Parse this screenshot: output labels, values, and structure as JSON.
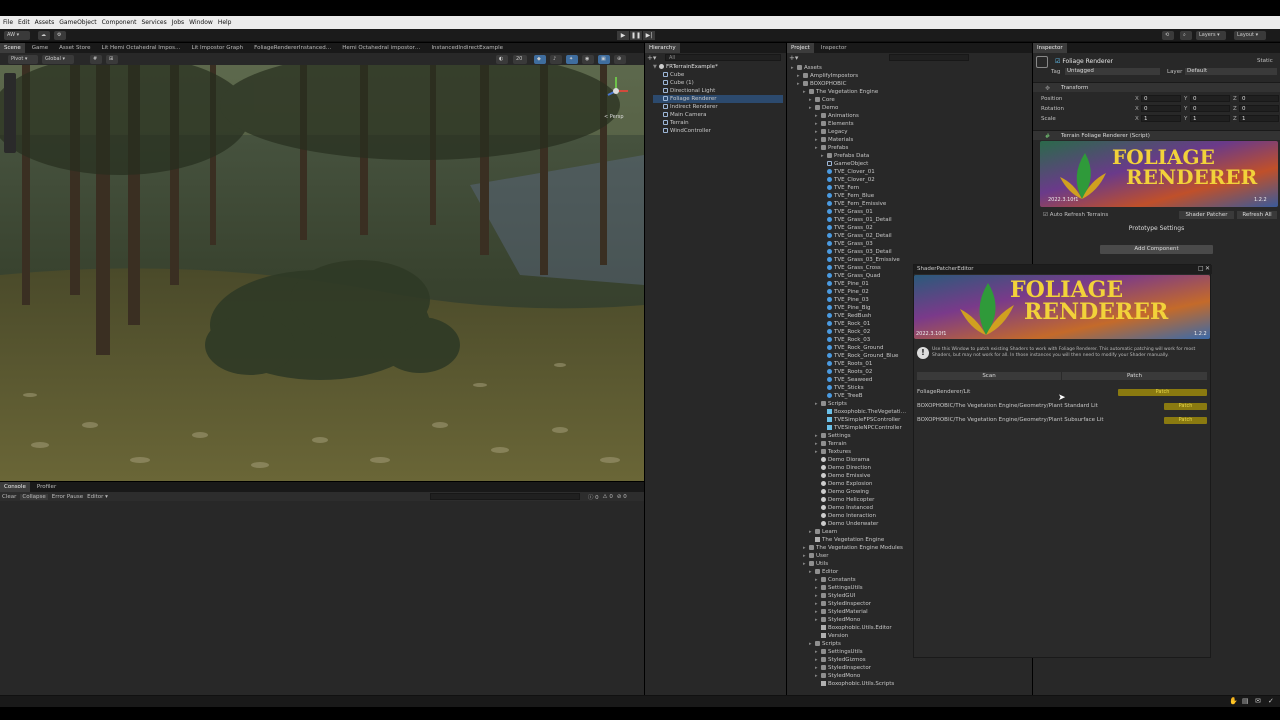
{
  "menu": [
    "File",
    "Edit",
    "Assets",
    "GameObject",
    "Component",
    "Services",
    "Jobs",
    "Window",
    "Help"
  ],
  "toolbar": {
    "account": "AW",
    "layers": "Layers",
    "layout": "Layout"
  },
  "scene_tabs": [
    "Scene",
    "Game",
    "Asset Store",
    "Lit Hemi Octahedral Impos…",
    "Lit Impostor Graph",
    "FoliageRendererInstanced…",
    "Hemi Octahedral impostor…",
    "InstancedIndirectExample"
  ],
  "scene_tools": {
    "pivot": "Pivot",
    "global": "Global",
    "persp": "< Persp",
    "grid_num": "20"
  },
  "console": {
    "tabs": [
      "Console",
      "Profiler"
    ],
    "clear": "Clear",
    "collapse": "Collapse",
    "error_pause": "Error Pause",
    "editor": "Editor",
    "count1": "0",
    "count2": "0",
    "count3": "0"
  },
  "hierarchy": {
    "title": "Hierarchy",
    "search_placeholder": "All",
    "scene": "FRTerrainExample*",
    "items": [
      "Cube",
      "Cube (1)",
      "Directional Light",
      "Foliage Renderer",
      "Indirect Renderer",
      "Main Camera",
      "Terrain",
      "WindController"
    ]
  },
  "project": {
    "tabs": [
      "Project",
      "Inspector"
    ],
    "items": [
      {
        "d": 0,
        "t": "Assets",
        "i": "folder"
      },
      {
        "d": 1,
        "t": "AmplifyImpostors",
        "i": "folder"
      },
      {
        "d": 1,
        "t": "BOXOPHOBIC",
        "i": "folder"
      },
      {
        "d": 2,
        "t": "The Vegetation Engine",
        "i": "folder"
      },
      {
        "d": 3,
        "t": "Core",
        "i": "folder"
      },
      {
        "d": 3,
        "t": "Demo",
        "i": "folder"
      },
      {
        "d": 4,
        "t": "Animations",
        "i": "folder"
      },
      {
        "d": 4,
        "t": "Elements",
        "i": "folder"
      },
      {
        "d": 4,
        "t": "Legacy",
        "i": "folder"
      },
      {
        "d": 4,
        "t": "Materials",
        "i": "folder"
      },
      {
        "d": 4,
        "t": "Prefabs",
        "i": "folder"
      },
      {
        "d": 5,
        "t": "Prefabs Data",
        "i": "folder"
      },
      {
        "d": 5,
        "t": "GameObject",
        "i": "cube"
      },
      {
        "d": 5,
        "t": "TVE_Clover_01",
        "i": "tve"
      },
      {
        "d": 5,
        "t": "TVE_Clover_02",
        "i": "tve"
      },
      {
        "d": 5,
        "t": "TVE_Fern",
        "i": "tve"
      },
      {
        "d": 5,
        "t": "TVE_Fern_Blue",
        "i": "tve"
      },
      {
        "d": 5,
        "t": "TVE_Fern_Emissive",
        "i": "tve"
      },
      {
        "d": 5,
        "t": "TVE_Grass_01",
        "i": "tve"
      },
      {
        "d": 5,
        "t": "TVE_Grass_01_Detail",
        "i": "tve"
      },
      {
        "d": 5,
        "t": "TVE_Grass_02",
        "i": "tve"
      },
      {
        "d": 5,
        "t": "TVE_Grass_02_Detail",
        "i": "tve"
      },
      {
        "d": 5,
        "t": "TVE_Grass_03",
        "i": "tve"
      },
      {
        "d": 5,
        "t": "TVE_Grass_03_Detail",
        "i": "tve"
      },
      {
        "d": 5,
        "t": "TVE_Grass_03_Emissive",
        "i": "tve"
      },
      {
        "d": 5,
        "t": "TVE_Grass_Cross",
        "i": "tve"
      },
      {
        "d": 5,
        "t": "TVE_Grass_Quad",
        "i": "tve"
      },
      {
        "d": 5,
        "t": "TVE_Pine_01",
        "i": "tve"
      },
      {
        "d": 5,
        "t": "TVE_Pine_02",
        "i": "tve"
      },
      {
        "d": 5,
        "t": "TVE_Pine_03",
        "i": "tve"
      },
      {
        "d": 5,
        "t": "TVE_Pine_Big",
        "i": "tve"
      },
      {
        "d": 5,
        "t": "TVE_RedBush",
        "i": "tve"
      },
      {
        "d": 5,
        "t": "TVE_Rock_01",
        "i": "tve"
      },
      {
        "d": 5,
        "t": "TVE_Rock_02",
        "i": "tve"
      },
      {
        "d": 5,
        "t": "TVE_Rock_03",
        "i": "tve"
      },
      {
        "d": 5,
        "t": "TVE_Rock_Ground",
        "i": "tve"
      },
      {
        "d": 5,
        "t": "TVE_Rock_Ground_Blue",
        "i": "tve"
      },
      {
        "d": 5,
        "t": "TVE_Roots_01",
        "i": "tve"
      },
      {
        "d": 5,
        "t": "TVE_Roots_02",
        "i": "tve"
      },
      {
        "d": 5,
        "t": "TVE_Seaweed",
        "i": "tve"
      },
      {
        "d": 5,
        "t": "TVE_Sticks",
        "i": "tve"
      },
      {
        "d": 5,
        "t": "TVE_TreeB",
        "i": "tve"
      },
      {
        "d": 4,
        "t": "Scripts",
        "i": "folder"
      },
      {
        "d": 5,
        "t": "Boxophobic.TheVegetati…",
        "i": "script"
      },
      {
        "d": 5,
        "t": "TVESimpleFPSController",
        "i": "script"
      },
      {
        "d": 5,
        "t": "TVESimpleNPCController",
        "i": "script"
      },
      {
        "d": 4,
        "t": "Settings",
        "i": "folder"
      },
      {
        "d": 4,
        "t": "Terrain",
        "i": "folder"
      },
      {
        "d": 4,
        "t": "Textures",
        "i": "folder"
      },
      {
        "d": 4,
        "t": "Demo Diorama",
        "i": "scene"
      },
      {
        "d": 4,
        "t": "Demo Direction",
        "i": "scene"
      },
      {
        "d": 4,
        "t": "Demo Emissive",
        "i": "scene"
      },
      {
        "d": 4,
        "t": "Demo Explosion",
        "i": "scene"
      },
      {
        "d": 4,
        "t": "Demo Growing",
        "i": "scene"
      },
      {
        "d": 4,
        "t": "Demo Helicopter",
        "i": "scene"
      },
      {
        "d": 4,
        "t": "Demo Instanced",
        "i": "scene"
      },
      {
        "d": 4,
        "t": "Demo Interaction",
        "i": "scene"
      },
      {
        "d": 4,
        "t": "Demo Underwater",
        "i": "scene"
      },
      {
        "d": 3,
        "t": "Learn",
        "i": "folder"
      },
      {
        "d": 3,
        "t": "The Vegetation Engine",
        "i": "asset"
      },
      {
        "d": 2,
        "t": "The Vegetation Engine Modules",
        "i": "folder"
      },
      {
        "d": 2,
        "t": "User",
        "i": "folder"
      },
      {
        "d": 2,
        "t": "Utils",
        "i": "folder"
      },
      {
        "d": 3,
        "t": "Editor",
        "i": "folder"
      },
      {
        "d": 4,
        "t": "Constants",
        "i": "folder"
      },
      {
        "d": 4,
        "t": "SettingsUtils",
        "i": "folder"
      },
      {
        "d": 4,
        "t": "StyledGUI",
        "i": "folder"
      },
      {
        "d": 4,
        "t": "StyledInspector",
        "i": "folder"
      },
      {
        "d": 4,
        "t": "StyledMaterial",
        "i": "folder"
      },
      {
        "d": 4,
        "t": "StyledMono",
        "i": "folder"
      },
      {
        "d": 4,
        "t": "Boxophobic.Utils.Editor",
        "i": "asset"
      },
      {
        "d": 4,
        "t": "Version",
        "i": "asset"
      },
      {
        "d": 3,
        "t": "Scripts",
        "i": "folder"
      },
      {
        "d": 4,
        "t": "SettingsUtils",
        "i": "folder"
      },
      {
        "d": 4,
        "t": "StyledGizmos",
        "i": "folder"
      },
      {
        "d": 4,
        "t": "StyledInspector",
        "i": "folder"
      },
      {
        "d": 4,
        "t": "StyledMono",
        "i": "folder"
      },
      {
        "d": 4,
        "t": "Boxophobic.Utils.Scripts",
        "i": "asset"
      }
    ]
  },
  "inspector": {
    "title": "Inspector",
    "object_name": "Foliage Renderer",
    "static": "Static",
    "tag_label": "Tag",
    "tag": "Untagged",
    "layer_label": "Layer",
    "layer": "Default",
    "transform": "Transform",
    "position": "Position",
    "rotation": "Rotation",
    "scale": "Scale",
    "pos": [
      "0",
      "0",
      "0"
    ],
    "rot": [
      "0",
      "0",
      "0"
    ],
    "scl": [
      "1",
      "1",
      "1"
    ],
    "script": "Terrain Foliage Renderer (Script)",
    "banner_line1": "FOLIAGE",
    "banner_line2": "RENDERER",
    "banner_ver_l": "2022.3.10f1",
    "banner_ver_r": "1.2.2",
    "auto_refresh": "Auto Refresh Terrains",
    "shader_patcher": "Shader Patcher",
    "refresh_all": "Refresh All",
    "prototype": "Prototype Settings",
    "add_component": "Add Component"
  },
  "patcher": {
    "title": "ShaderPatcherEditor",
    "banner_line1": "FOLIAGE",
    "banner_line2": "RENDERER",
    "ver_l": "2022.3.10f1",
    "ver_r": "1.2.2",
    "info": "Use this Window to patch existing Shaders to work with Foliage Renderer. This automatic patching will work for most Shaders, but may not work for all. In those instances you will then need to modify your Shader manually.",
    "scan": "Scan",
    "patch": "Patch",
    "rows": [
      {
        "name": "FoliageRenderer/Lit",
        "btn": "Patch"
      },
      {
        "name": "BOXOPHOBIC/The Vegetation Engine/Geometry/Plant Standard Lit",
        "btn": "Patch"
      },
      {
        "name": "BOXOPHOBIC/The Vegetation Engine/Geometry/Plant Subsurface Lit",
        "btn": "Patch"
      }
    ]
  }
}
